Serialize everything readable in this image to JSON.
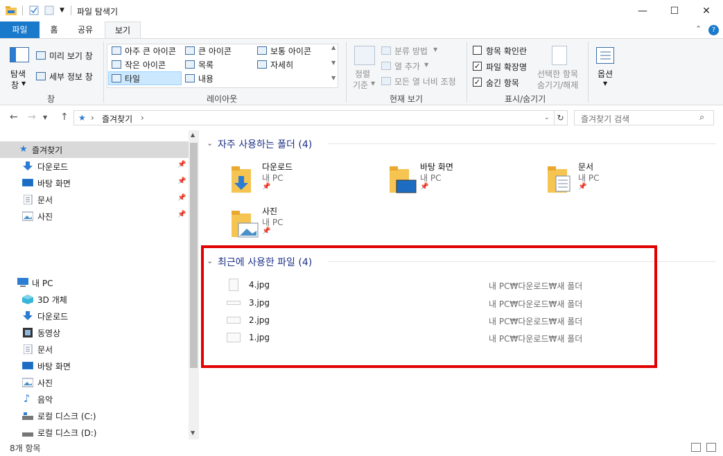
{
  "window": {
    "title": "파일 탐색기",
    "controls": {
      "minimize": "—",
      "maximize": "☐",
      "close": "✕"
    }
  },
  "tabs": {
    "file": "파일",
    "home": "홈",
    "share": "공유",
    "view": "보기"
  },
  "ribbon": {
    "pane_group": {
      "nav_pane_line1": "탐색",
      "nav_pane_line2": "창",
      "preview_pane": "미리 보기 창",
      "details_pane": "세부 정보 창",
      "label": "창"
    },
    "layout_group": {
      "extra_large": "아주 큰 아이콘",
      "large": "큰 아이콘",
      "medium": "보통 아이콘",
      "small": "작은 아이콘",
      "list": "목록",
      "details": "자세히",
      "tiles": "타일",
      "content": "내용",
      "label": "레이아웃"
    },
    "current_view_group": {
      "sort_line1": "정렬",
      "sort_line2": "기준",
      "group_by": "분류 방법",
      "add_columns": "열 추가",
      "size_columns": "모든 열 너비 조정",
      "label": "현재 보기"
    },
    "show_hide_group": {
      "item_checkboxes": "항목 확인란",
      "file_extensions": "파일 확장명",
      "hidden_items": "숨긴 항목",
      "hide_selected_line1": "선택한 항목",
      "hide_selected_line2": "숨기기/해제",
      "label": "표시/숨기기",
      "item_checkboxes_checked": false,
      "file_extensions_checked": true,
      "hidden_items_checked": true
    },
    "options": {
      "label": "옵션"
    }
  },
  "address": {
    "path": "즐겨찾기",
    "search_placeholder": "즐겨찾기 검색"
  },
  "nav": {
    "quick_access": "즐겨찾기",
    "quick_items": [
      "다운로드",
      "바탕 화면",
      "문서",
      "사진"
    ],
    "this_pc": "내 PC",
    "pc_items": [
      "3D 개체",
      "다운로드",
      "동영상",
      "문서",
      "바탕 화면",
      "사진",
      "음악",
      "로컬 디스크 (C:)",
      "로컬 디스크 (D:)"
    ]
  },
  "content": {
    "frequent_header": "자주 사용하는 폴더 (4)",
    "frequent": [
      {
        "name": "다운로드",
        "location": "내 PC"
      },
      {
        "name": "바탕 화면",
        "location": "내 PC"
      },
      {
        "name": "문서",
        "location": "내 PC"
      },
      {
        "name": "사진",
        "location": "내 PC"
      }
    ],
    "recent_header": "최근에 사용한 파일 (4)",
    "recent": [
      {
        "name": "4.jpg",
        "path": "내 PC₩다운로드₩새 폴더"
      },
      {
        "name": "3.jpg",
        "path": "내 PC₩다운로드₩새 폴더"
      },
      {
        "name": "2.jpg",
        "path": "내 PC₩다운로드₩새 폴더"
      },
      {
        "name": "1.jpg",
        "path": "내 PC₩다운로드₩새 폴더"
      }
    ]
  },
  "status": {
    "count": "8개 항목"
  },
  "colors": {
    "accent": "#1979ca",
    "highlight": "#e00000",
    "folder": "#f5c451",
    "group_header": "#1e3287"
  }
}
